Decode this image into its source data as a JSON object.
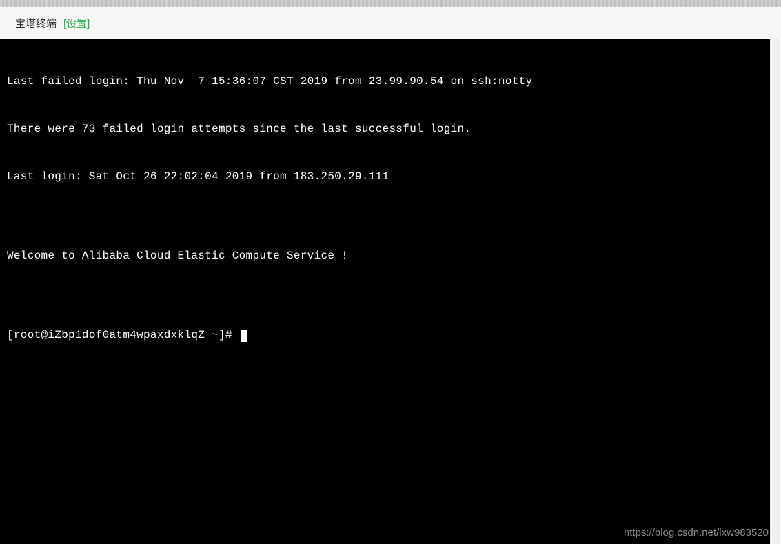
{
  "header": {
    "title": "宝塔终端",
    "settings_label": "[设置]"
  },
  "terminal": {
    "lines": [
      "Last failed login: Thu Nov  7 15:36:07 CST 2019 from 23.99.90.54 on ssh:notty",
      "There were 73 failed login attempts since the last successful login.",
      "Last login: Sat Oct 26 22:02:04 2019 from 183.250.29.111",
      "",
      "Welcome to Alibaba Cloud Elastic Compute Service !",
      ""
    ],
    "prompt": "[root@iZbp1dof0atm4wpaxdxklqZ ~]# "
  },
  "watermark": "https://blog.csdn.net/lxw983520"
}
